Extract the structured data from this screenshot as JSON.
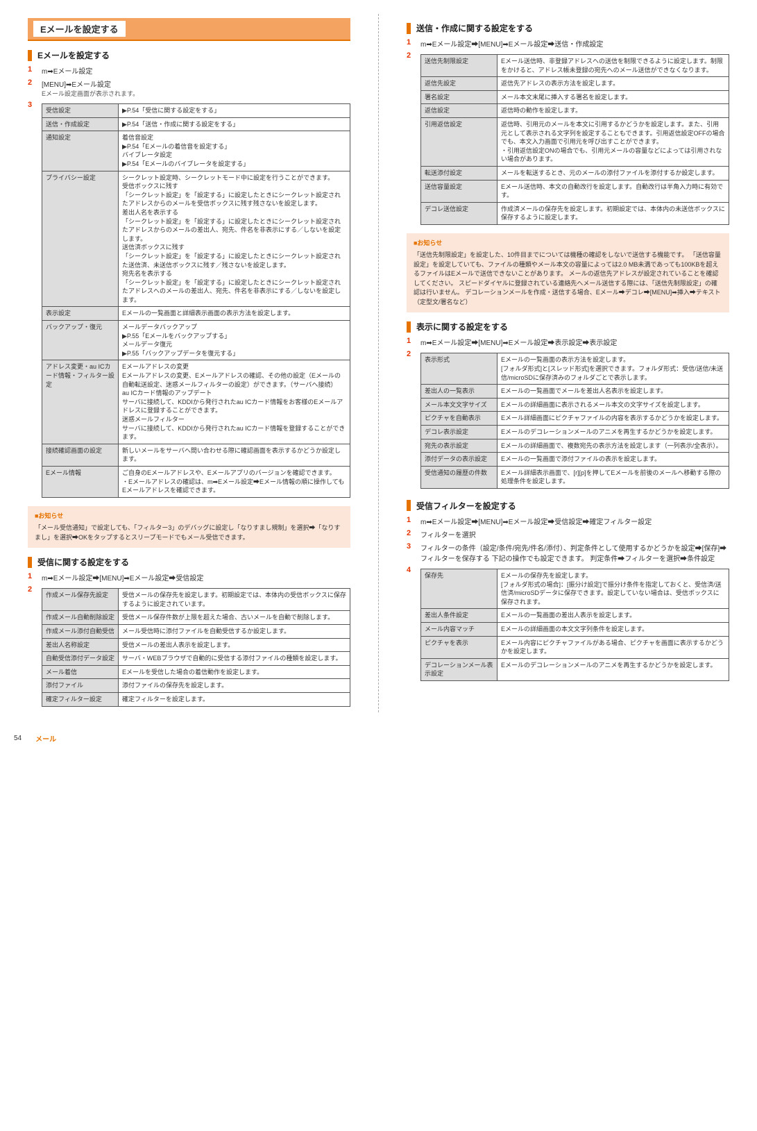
{
  "page_number": "54",
  "footer_label": "メール",
  "left": {
    "band_title": "Eメールを設定する",
    "sec1": {
      "title": "Eメールを設定する",
      "step1": "m➡Eメール設定",
      "step2": "[MENU]➡Eメール設定",
      "step2_note": "Eメール設定画面が表示されます。",
      "table": [
        {
          "k": "受信設定",
          "v": "▶P.54「受信に関する設定をする」"
        },
        {
          "k": "送信・作成設定",
          "v": "▶P.54「送信・作成に関する設定をする」"
        },
        {
          "k": "通知設定",
          "v": "着信音設定\n▶P.54「Eメールの着信音を設定する」\nバイブレータ設定\n▶P.54「Eメールのバイブレータを設定する」"
        },
        {
          "k": "プライバシー設定",
          "v": "シークレット設定時、シークレットモード中に設定を行うことができます。\n受信ボックスに残す\n「シークレット設定」を「設定する」に設定したときにシークレット設定されたアドレスからのメールを受信ボックスに残す残さないを設定します。\n差出人名を表示する\n「シークレット設定」を「設定する」に設定したときにシークレット設定されたアドレスからのメールの差出人、宛先、件名を非表示にする／しないを設定します。\n送信済ボックスに残す\n「シークレット設定」を「設定する」に設定したときにシークレット設定された送信済、未送信ボックスに残す／残さないを設定します。\n宛先名を表示する\n「シークレット設定」を「設定する」に設定したときにシークレット設定されたアドレスへのメールの差出人、宛先、件名を非表示にする／しないを設定します。"
        },
        {
          "k": "表示設定",
          "v": "Eメールの一覧画面と詳細表示画面の表示方法を設定します。"
        },
        {
          "k": "バックアップ・復元",
          "v": "メールデータバックアップ\n▶P.55「Eメールをバックアップする」\nメールデータ復元\n▶P.55「バックアップデータを復元する」"
        },
        {
          "k": "アドレス変更・au ICカード情報・フィルター設定",
          "v": "Eメールアドレスの変更\nEメールアドレスの変更、Eメールアドレスの確認、その他の設定（Eメールの自動転送設定、迷惑メールフィルターの設定）ができます。（サーバへ接続）\nau ICカード情報のアップデート\nサーバに接続して、KDDIから発行されたau ICカード情報をお客様のEメールアドレスに登録することができます。\n迷惑メールフィルター\nサーバに接続して、KDDIから発行されたau ICカード情報を登録することができます。"
        },
        {
          "k": "接続確認画面の設定",
          "v": "新しいメールをサーバへ問い合わせる際に確認画面を表示するかどうか設定します。"
        },
        {
          "k": "Eメール情報",
          "v": "ご自身のEメールアドレスや、Eメールアプリのバージョンを確認できます。\n・Eメールアドレスの確認は、m➡Eメール設定➡Eメール情報の順に操作してもEメールアドレスを確認できます。"
        }
      ]
    },
    "note1": {
      "head": "■お知らせ",
      "body": "「メール受信通知」で設定しても、「フィルター3」のデバッグに設定し「なりすまし規制」を選択➡「なりすまし」を選択➡OKをタップするとスリープモードでもメール受信できます。"
    },
    "sec2": {
      "title": "受信に関する設定をする",
      "step1": "m➡Eメール設定➡[MENU]➡Eメール設定➡受信設定",
      "table": [
        {
          "k": "作成メール保存先設定",
          "v": "受信メールの保存先を設定します。初期設定では、本体内の受信ボックスに保存するように設定されています。"
        },
        {
          "k": "作成メール自動削除設定",
          "v": "受信メール保存件数が上限を超えた場合、古いメールを自動で削除します。"
        },
        {
          "k": "作成メール添付自動受信",
          "v": "メール受信時に添付ファイルを自動受信するか設定します。"
        },
        {
          "k": "差出人名称設定",
          "v": "受信メールの差出人表示を設定します。"
        },
        {
          "k": "自動受信添付データ設定",
          "v": "サーバ・WEBブラウザで自動的に受信する添付ファイルの種類を設定します。"
        },
        {
          "k": "メール着信",
          "v": "Eメールを受信した場合の着信動作を設定します。"
        },
        {
          "k": "添付ファイル",
          "v": "添付ファイルの保存先を設定します。"
        },
        {
          "k": "確定フィルター設定",
          "v": "確定フィルターを設定します。"
        }
      ]
    }
  },
  "right": {
    "sec1": {
      "title": "送信・作成に関する設定をする",
      "step1": "m➡Eメール設定➡[MENU]➡Eメール設定➡送信・作成設定",
      "table": [
        {
          "k": "送信先制限設定",
          "v": "Eメール送信時、非登録アドレスへの送信を制限できるように設定します。制限をかけると、アドレス帳未登録の宛先へのメール送信ができなくなります。"
        },
        {
          "k": "返信先設定",
          "v": "返信先アドレスの表示方法を設定します。"
        },
        {
          "k": "署名設定",
          "v": "メール本文末尾に挿入する署名を設定します。"
        },
        {
          "k": "返信設定",
          "v": "返信時の動作を設定します。"
        },
        {
          "k": "引用返信設定",
          "v": "返信時、引用元のメールを本文に引用するかどうかを設定します。また、引用元として表示される文字列を設定することもできます。引用返信設定OFFの場合でも、本文入力画面で引用元を呼び出すことができます。\n・引用返信設定ONの場合でも、引用元メールの容量などによっては引用されない場合があります。"
        },
        {
          "k": "転送添付設定",
          "v": "メールを転送するとき、元のメールの添付ファイルを添付するか設定します。"
        },
        {
          "k": "送信容量設定",
          "v": "Eメール送信時、本文の自動改行を設定します。自動改行は半角入力時に有効です。"
        },
        {
          "k": "デコレ送信設定",
          "v": "作成済メールの保存先を設定します。初期設定では、本体内の未送信ボックスに保存するように設定します。"
        }
      ],
      "note": {
        "head": "■お知らせ",
        "body": "「送信先制限設定」を設定した、10件目までについては機種の確認をしないで送信する機能です。\n「送信容量設定」を設定していても、ファイルの種類やメール本文の容量によっては2.0 MB未満であっても100KBを超えるファイルはEメールで送信できないことがあります。\nメールの返信先アドレスが設定されていることを確認してください。\nスピードダイヤルに登録されている連絡先へメール送信する際には、「送信先制限設定」の確認は行いません。\nデコレーションメールを作成・送信する場合、Eメール➡デコレ➡[MENU]➡挿入➡テキスト（定型文/署名など）"
      }
    },
    "sec2": {
      "title": "表示に関する設定をする",
      "step1": "m➡Eメール設定➡[MENU]➡Eメール設定➡表示設定➡表示設定",
      "table": [
        {
          "k": "表示形式",
          "v": "Eメールの一覧画面の表示方法を設定します。\n[フォルダ形式]と[スレッド形式]を選択できます。フォルダ形式：受信/送信/未送信/microSDに保存済みのフォルダごとで表示します。"
        },
        {
          "k": "差出人の一覧表示",
          "v": "Eメールの一覧画面でメールを差出人名表示を設定します。"
        },
        {
          "k": "メール本文文字サイズ",
          "v": "Eメールの詳細画面に表示されるメール本文の文字サイズを設定します。"
        },
        {
          "k": "ピクチャを自動表示",
          "v": "Eメール詳細画面にピクチャファイルの内容を表示するかどうかを設定します。"
        },
        {
          "k": "デコレ表示設定",
          "v": "Eメールのデコレーションメールのアニメを再生するかどうかを設定します。"
        },
        {
          "k": "宛先の表示設定",
          "v": "Eメールの詳細画面で、複数宛先の表示方法を設定します（一列表示/全表示）。"
        },
        {
          "k": "添付データの表示設定",
          "v": "Eメールの一覧画面で添付ファイルの表示を設定します。"
        },
        {
          "k": "受信通知の履歴の件数",
          "v": "Eメール詳細表示画面で、[r][p]を押してEメールを前後のメールへ移動する際の処理条件を設定します。"
        }
      ]
    },
    "sec3": {
      "title": "受信フィルターを設定する",
      "step1": "m➡Eメール設定➡[MENU]➡Eメール設定➡受信設定➡確定フィルター設定",
      "step2": "フィルターを選択",
      "step3": "フィルターの条件（設定/条件/宛先/件名/添付）、判定条件として使用するかどうかを設定➡[保存]➡フィルターを保存する\n下記の操作でも設定できます。\n判定条件➡フィルターを選択➡条件設定",
      "table": [
        {
          "k": "保存先",
          "v": "Eメールの保存先を設定します。\n[フォルダ形式の場合]：[振分け設定]で振分け条件を指定しておくと、受信済/送信済/microSDデータに保存できます。設定していない場合は、受信ボックスに保存されます。"
        },
        {
          "k": "差出人条件設定",
          "v": "Eメールの一覧画面の差出人表示を設定します。"
        },
        {
          "k": "メール内容マッチ",
          "v": "Eメールの詳細画面の本文文字列条件を設定します。"
        },
        {
          "k": "ピクチャを表示",
          "v": "Eメール内容にピクチャファイルがある場合、ピクチャを画面に表示するかどうかを設定します。"
        },
        {
          "k": "デコレーションメール表示設定",
          "v": "Eメールのデコレーションメールのアニメを再生するかどうかを設定します。"
        }
      ]
    }
  }
}
